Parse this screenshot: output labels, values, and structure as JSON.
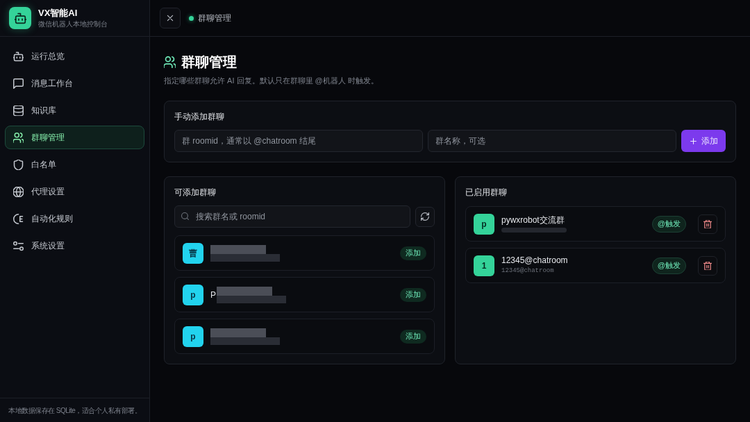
{
  "app": {
    "title": "VX智能AI",
    "subtitle": "微信机器人本地控制台"
  },
  "sidebar": {
    "items": [
      {
        "label": "运行总览",
        "selected": false
      },
      {
        "label": "消息工作台",
        "selected": false
      },
      {
        "label": "知识库",
        "selected": false
      },
      {
        "label": "群聊管理",
        "selected": true
      },
      {
        "label": "白名单",
        "selected": false
      },
      {
        "label": "代理设置",
        "selected": false
      },
      {
        "label": "自动化规则",
        "selected": false
      },
      {
        "label": "系统设置",
        "selected": false
      }
    ],
    "footer": "本地数据保存在 SQLite，适合个人私有部署。"
  },
  "header": {
    "breadcrumb": "群聊管理"
  },
  "page": {
    "title": "群聊管理",
    "description": "指定哪些群聊允许 AI 回复。默认只在群聊里 @机器人 时触发。"
  },
  "manual_add": {
    "title": "手动添加群聊",
    "roomid_field": {
      "placeholder": "群 roomid，通常以 @chatroom 结尾"
    },
    "name_field": {
      "placeholder": "群名称，可选"
    },
    "button": "添加"
  },
  "available": {
    "title": "可添加群聊",
    "search": {
      "placeholder": "搜索群名或 roomid"
    },
    "items": [
      {
        "avatar": "曹",
        "action": "添加"
      },
      {
        "avatar": "p",
        "name": "P",
        "action": "添加"
      },
      {
        "avatar": "p",
        "action": "添加"
      }
    ]
  },
  "enabled": {
    "title": "已启用群聊",
    "items": [
      {
        "avatar": "p",
        "name": "pywxrobot交流群",
        "badge": "@触发"
      },
      {
        "avatar": "1",
        "name": "12345@chatroom",
        "roomid": "12345@chatroom",
        "badge": "@触发"
      }
    ]
  }
}
